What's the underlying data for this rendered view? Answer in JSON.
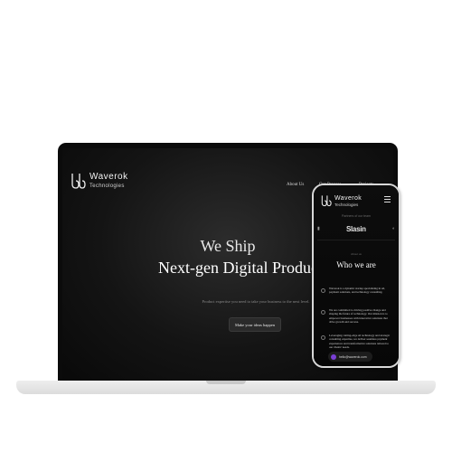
{
  "site": {
    "brand": "Waverok",
    "tagline": "Technologies",
    "nav": [
      "About Us",
      "Our Process",
      "Projects"
    ],
    "hero_line1_accent": "We Ship",
    "hero_line2": "Next-gen Digital Products",
    "hero_sub": "Product expertise you need to take your business to the next level.",
    "cta": "Make your ideas happen"
  },
  "phone": {
    "brand": "Waverok",
    "tagline": "Technologies",
    "partners_label": "Partners of our team",
    "partners": [
      "",
      "Slasin",
      ""
    ],
    "section_label": "About us",
    "section_title": "Who we are",
    "cards": [
      "Waverok is a dynamic startup specializing in AI, payment solutions, and technology consulting.",
      "We are committed to driving positive change and shaping the future of technology. Our mission is to empower businesses with innovative solutions that drive growth and success.",
      "Leveraging cutting-edge AI technology and strategic consulting expertise, we deliver seamless payment experiences and transformative solutions tailored to our clients' needs."
    ],
    "email": "hello@waverok.com"
  },
  "colors": {
    "screen_bg": "#0b0b0b",
    "accent": "#7a3fd6",
    "frame": "#e3e3e3"
  }
}
